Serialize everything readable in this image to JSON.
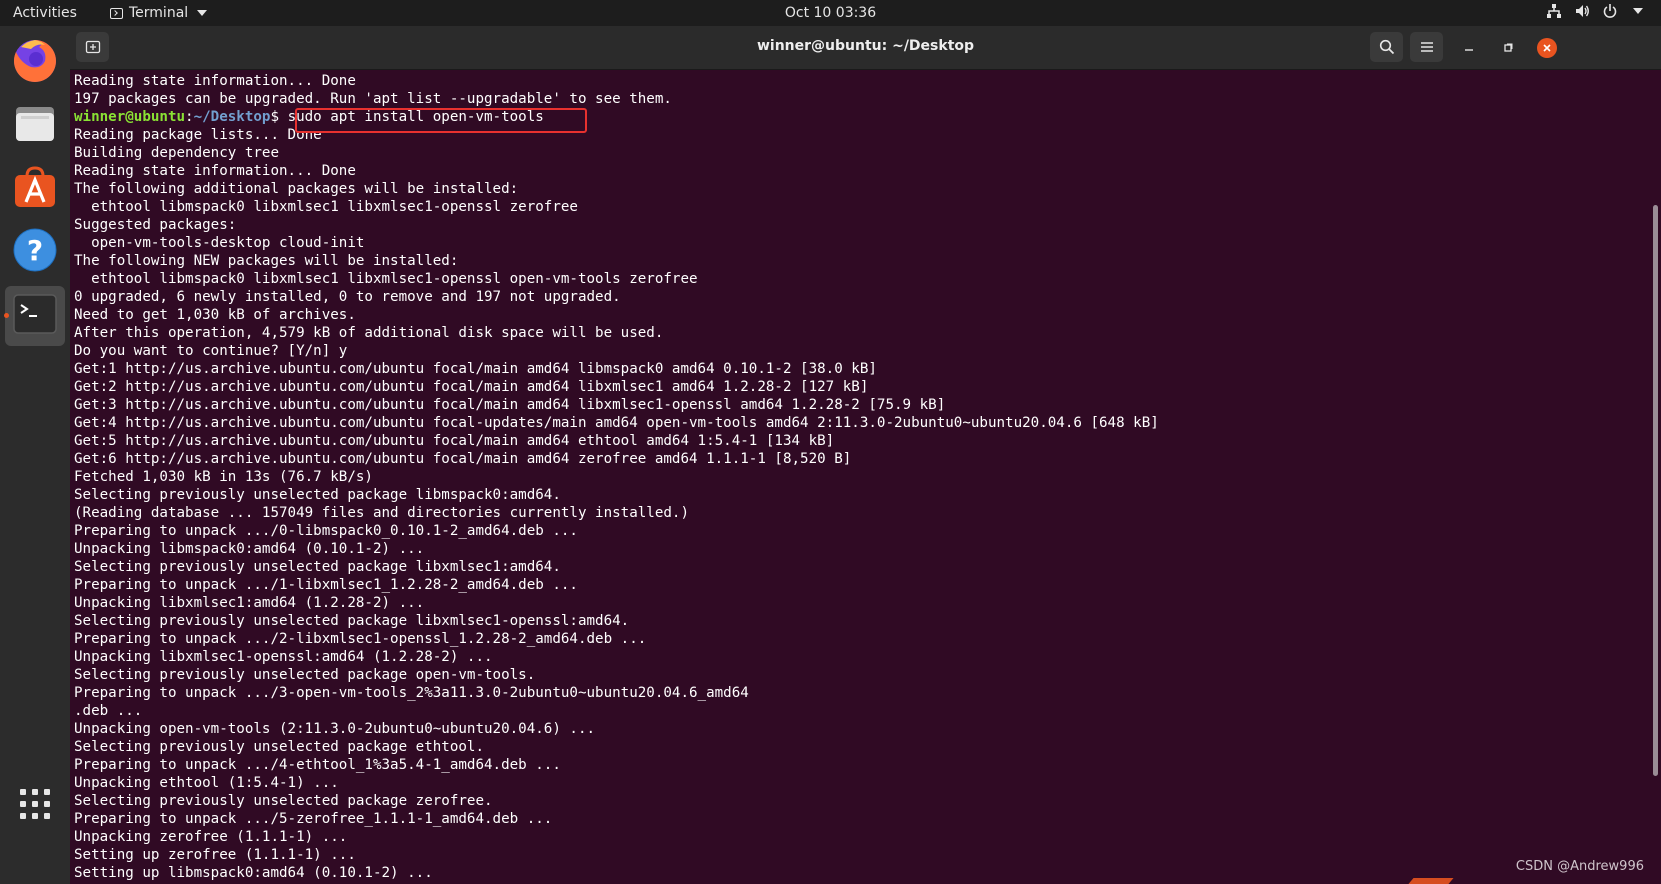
{
  "topbar": {
    "activities_label": "Activities",
    "app_menu_label": "Terminal",
    "clock": "Oct 10  03:36"
  },
  "dock": {
    "items": [
      "firefox-icon",
      "files-icon",
      "software-icon",
      "help-icon",
      "terminal-icon",
      "show-apps-icon"
    ],
    "active_item": "terminal-icon"
  },
  "window": {
    "title": "winner@ubuntu: ~/Desktop"
  },
  "terminal": {
    "prompt_user": "winner@ubuntu",
    "prompt_path": "~/Desktop",
    "prompt_sep": ":",
    "prompt_end": "$ ",
    "command": "sudo apt install open-vm-tools",
    "lines": [
      "Reading state information... Done",
      "197 packages can be upgraded. Run 'apt list --upgradable' to see them.",
      "",
      "Reading package lists... Done",
      "Building dependency tree",
      "Reading state information... Done",
      "The following additional packages will be installed:",
      "  ethtool libmspack0 libxmlsec1 libxmlsec1-openssl zerofree",
      "Suggested packages:",
      "  open-vm-tools-desktop cloud-init",
      "The following NEW packages will be installed:",
      "  ethtool libmspack0 libxmlsec1 libxmlsec1-openssl open-vm-tools zerofree",
      "0 upgraded, 6 newly installed, 0 to remove and 197 not upgraded.",
      "Need to get 1,030 kB of archives.",
      "After this operation, 4,579 kB of additional disk space will be used.",
      "Do you want to continue? [Y/n] y",
      "Get:1 http://us.archive.ubuntu.com/ubuntu focal/main amd64 libmspack0 amd64 0.10.1-2 [38.0 kB]",
      "Get:2 http://us.archive.ubuntu.com/ubuntu focal/main amd64 libxmlsec1 amd64 1.2.28-2 [127 kB]",
      "Get:3 http://us.archive.ubuntu.com/ubuntu focal/main amd64 libxmlsec1-openssl amd64 1.2.28-2 [75.9 kB]",
      "Get:4 http://us.archive.ubuntu.com/ubuntu focal-updates/main amd64 open-vm-tools amd64 2:11.3.0-2ubuntu0~ubuntu20.04.6 [648 kB]",
      "Get:5 http://us.archive.ubuntu.com/ubuntu focal/main amd64 ethtool amd64 1:5.4-1 [134 kB]",
      "Get:6 http://us.archive.ubuntu.com/ubuntu focal/main amd64 zerofree amd64 1.1.1-1 [8,520 B]",
      "Fetched 1,030 kB in 13s (76.7 kB/s)",
      "Selecting previously unselected package libmspack0:amd64.",
      "(Reading database ... 157049 files and directories currently installed.)",
      "Preparing to unpack .../0-libmspack0_0.10.1-2_amd64.deb ...",
      "Unpacking libmspack0:amd64 (0.10.1-2) ...",
      "Selecting previously unselected package libxmlsec1:amd64.",
      "Preparing to unpack .../1-libxmlsec1_1.2.28-2_amd64.deb ...",
      "Unpacking libxmlsec1:amd64 (1.2.28-2) ...",
      "Selecting previously unselected package libxmlsec1-openssl:amd64.",
      "Preparing to unpack .../2-libxmlsec1-openssl_1.2.28-2_amd64.deb ...",
      "Unpacking libxmlsec1-openssl:amd64 (1.2.28-2) ...",
      "Selecting previously unselected package open-vm-tools.",
      "Preparing to unpack .../3-open-vm-tools_2%3a11.3.0-2ubuntu0~ubuntu20.04.6_amd64",
      ".deb ...",
      "Unpacking open-vm-tools (2:11.3.0-2ubuntu0~ubuntu20.04.6) ...",
      "Selecting previously unselected package ethtool.",
      "Preparing to unpack .../4-ethtool_1%3a5.4-1_amd64.deb ...",
      "Unpacking ethtool (1:5.4-1) ...",
      "Selecting previously unselected package zerofree.",
      "Preparing to unpack .../5-zerofree_1.1.1-1_amd64.deb ...",
      "Unpacking zerofree (1.1.1-1) ...",
      "Setting up zerofree (1.1.1-1) ...",
      "Setting up libmspack0:amd64 (0.10.1-2) ..."
    ]
  },
  "watermark": "CSDN @Andrew996",
  "colors": {
    "terminal_bg": "#300a24",
    "prompt_user": "#8ae234",
    "prompt_path": "#729fcf",
    "highlight_box": "#e8312f",
    "accent": "#e95420"
  }
}
